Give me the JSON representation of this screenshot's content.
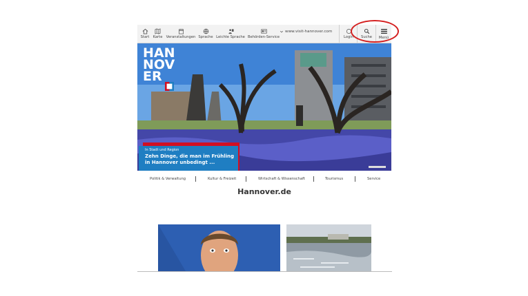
{
  "toolbar": {
    "items": [
      {
        "label": "Start",
        "icon": "home-icon"
      },
      {
        "label": "Karte",
        "icon": "map-icon"
      },
      {
        "label": "Veranstaltungen",
        "icon": "calendar-icon"
      },
      {
        "label": "Sprache",
        "icon": "globe-icon"
      },
      {
        "label": "Leichte Sprache",
        "icon": "easy-language-icon"
      },
      {
        "label": "Behörden-Service",
        "icon": "id-card-icon"
      }
    ],
    "url": "www.visit-hannover.com",
    "login_label": "Login",
    "search_label": "Suche",
    "menu_label": "Menü"
  },
  "hero": {
    "logo_lines": [
      "HAN",
      "NOV",
      "ER"
    ],
    "kicker": "In Stadt und Region",
    "headline": "Zehn Dinge, die man im Frühling in Hannover unbedingt ..."
  },
  "nav": [
    "Politik & Verwaltung",
    "Kultur & Freizeit",
    "Wirtschaft & Wissenschaft",
    "Tourismus",
    "Service"
  ],
  "page_title": "Hannover.de",
  "colors": {
    "accent_red": "#d20f22",
    "accent_blue": "#1f7ec2",
    "annotation_circle": "#d42020"
  }
}
